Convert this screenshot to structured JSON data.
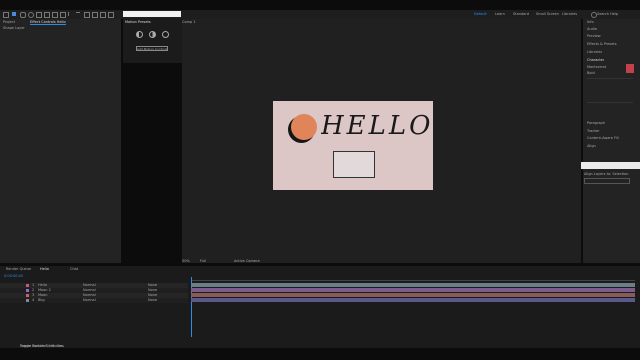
{
  "toolbar": {
    "workspaces": [
      "Default",
      "Learn",
      "Standard",
      "Small Screen",
      "Libraries"
    ],
    "active_workspace": "Default",
    "search_label": "Search Help"
  },
  "project_panel": {
    "tabs": [
      "Project",
      "Effect Controls Hello"
    ],
    "subtitle": "Shape Layer"
  },
  "effect_panel": {
    "tab": "Motion Presets",
    "phase_icons": [
      "moon-crescent-icon",
      "moon-half-icon",
      "moon-full-icon"
    ],
    "button_label": "Add Motion Controls"
  },
  "composition": {
    "tab": "Comp 1",
    "title_text": "HELLO",
    "zoom": "50%",
    "quality": "Full",
    "camera": "Active Camera"
  },
  "right_panel": {
    "items": [
      "Info",
      "Audio",
      "Preview",
      "Effects & Presets",
      "Libraries",
      "Character"
    ],
    "font_name": "Montserrat",
    "font_style": "Bold",
    "sections": [
      "Paragraph",
      "Tracker",
      "Content-Aware Fill",
      "Align"
    ],
    "align_label": "Align Layers to: Selection"
  },
  "timeline": {
    "tabs": [
      "Render Queue",
      "Hello",
      "Chat"
    ],
    "active_tab": "Hello",
    "timecode": "0:00:00:00",
    "layers": [
      {
        "num": "1",
        "name": "Hello",
        "mode": "Normal",
        "parent": "None",
        "color": "#c9587a"
      },
      {
        "num": "2",
        "name": "Moon 2",
        "mode": "Normal",
        "parent": "None",
        "color": "#8f6ad1"
      },
      {
        "num": "3",
        "name": "Moon",
        "mode": "Normal",
        "parent": "None",
        "color": "#d45d5d"
      },
      {
        "num": "4",
        "name": "Bkg",
        "mode": "Normal",
        "parent": "None",
        "color": "#7a8c9c"
      }
    ],
    "track_colors": [
      "#6a7f8a",
      "#7b5c8a",
      "#8a5a5a",
      "#5a5a8a"
    ],
    "status": "Frame Render Time: 0ms",
    "toggle": "Toggle Switches / Modes"
  },
  "colors": {
    "accent": "#2d8ceb",
    "comp_bg": "#dcc6c6",
    "moon": "#e0855a"
  }
}
